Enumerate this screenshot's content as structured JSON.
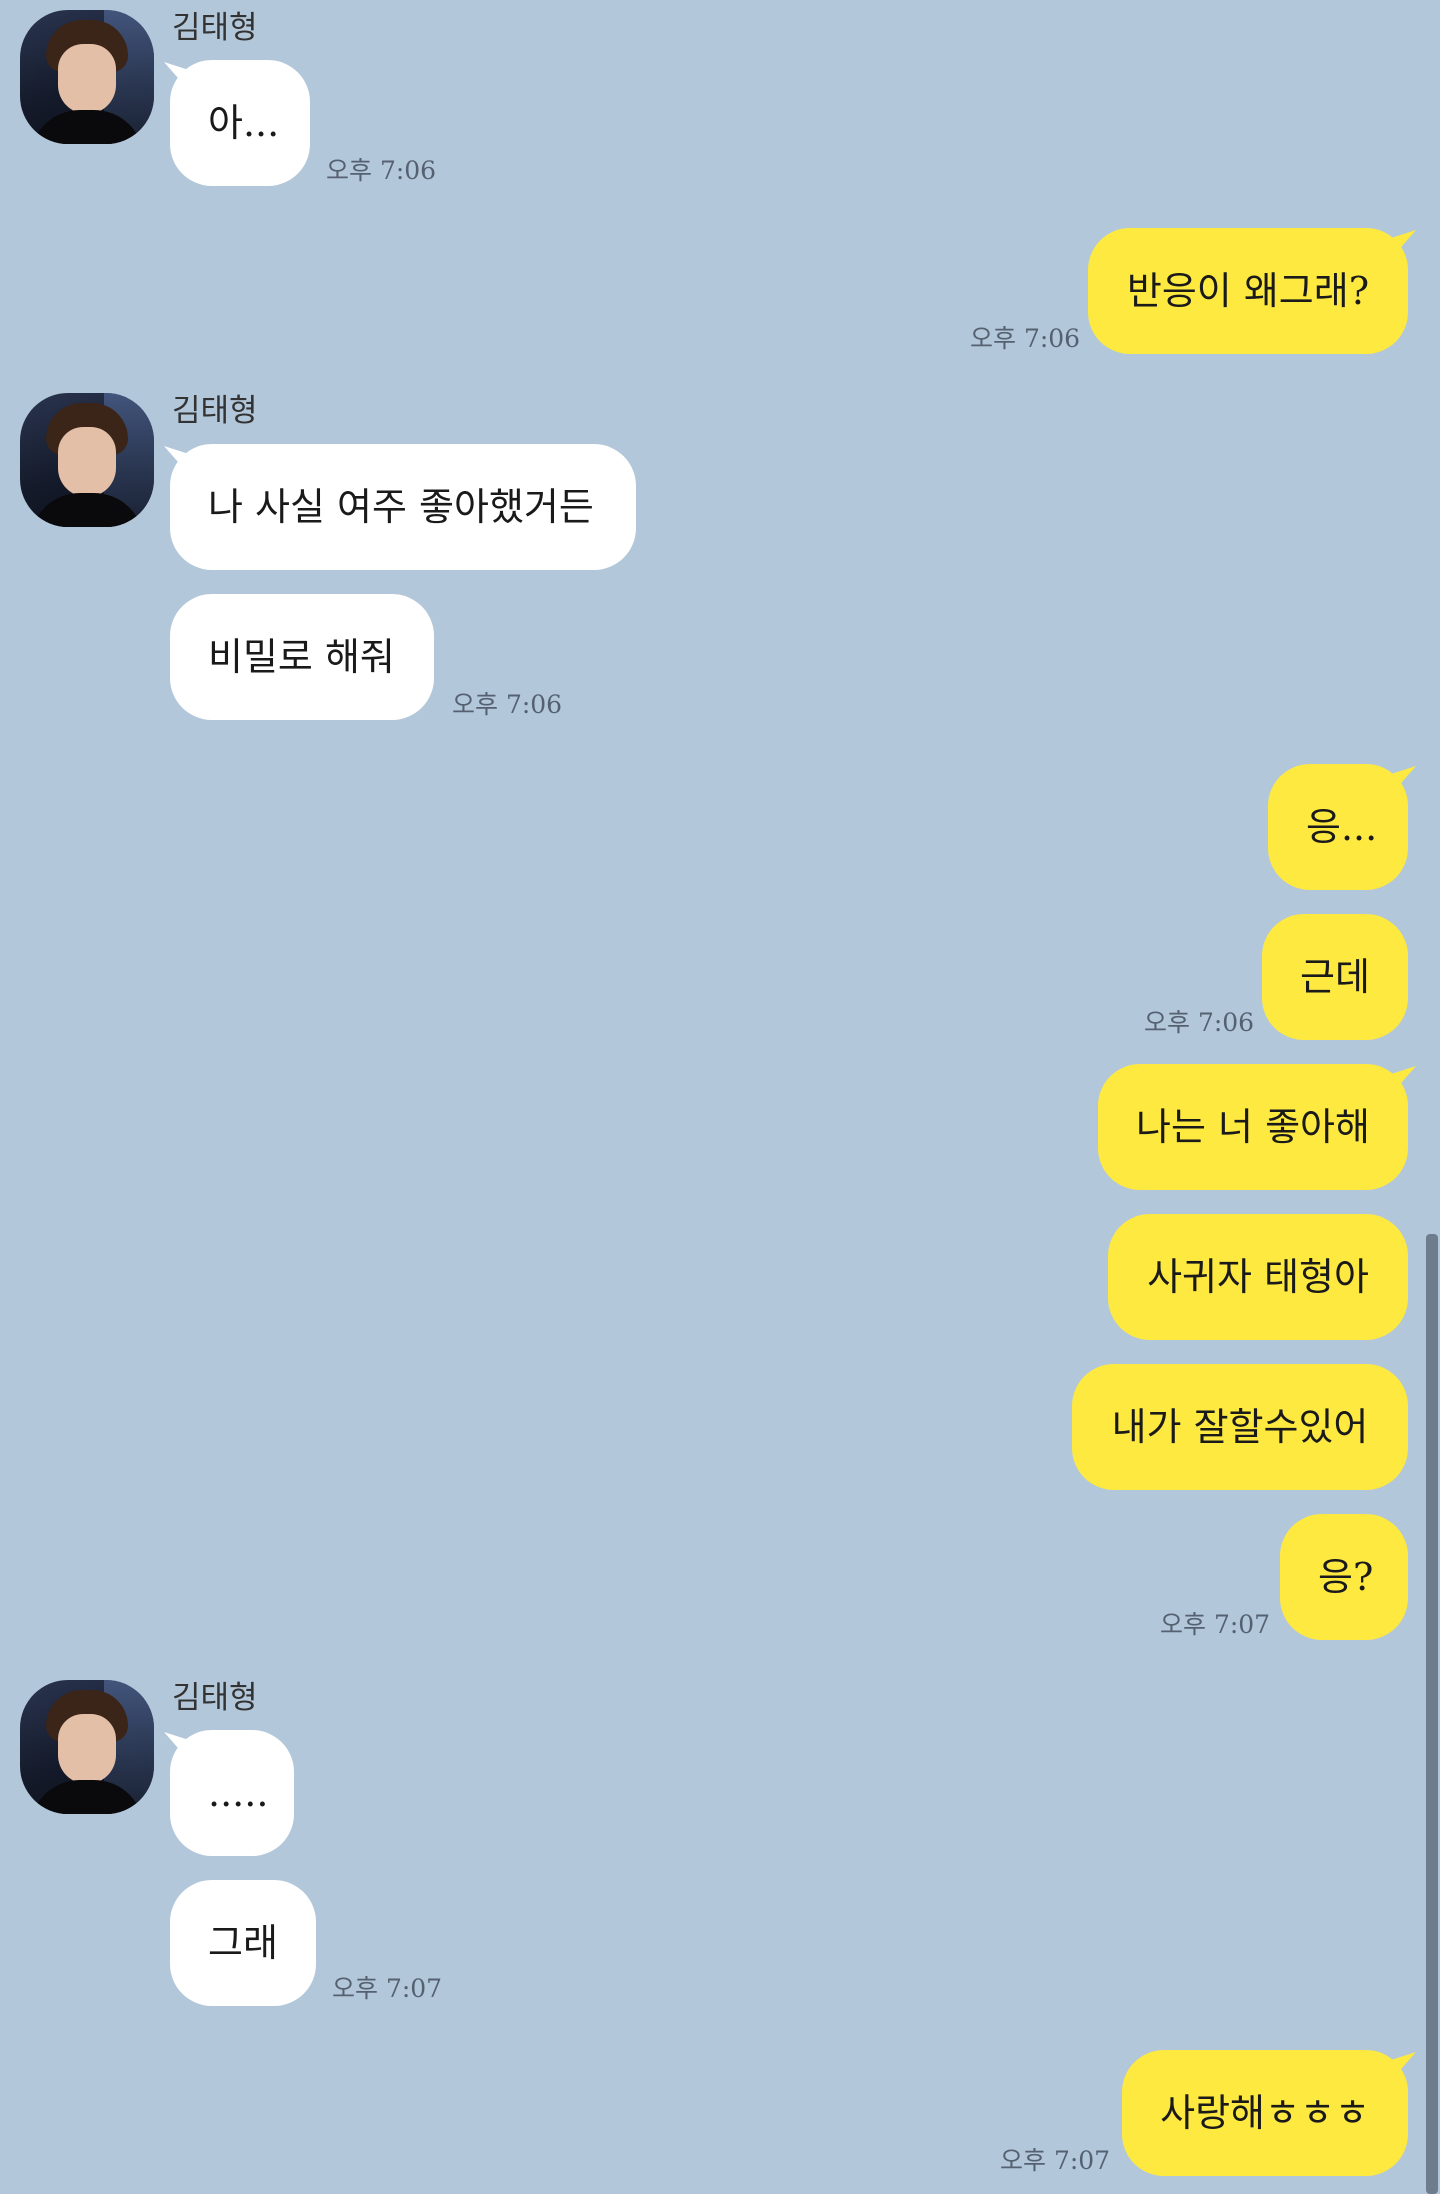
{
  "contact": {
    "name": "김태형"
  },
  "messages": {
    "m1": "아...",
    "m2": "반응이 왜그래?",
    "m3": "나 사실 여주 좋아했거든",
    "m4": "비밀로 해줘",
    "m5": "응...",
    "m6": "근데",
    "m7": "나는 너 좋아해",
    "m8": "사귀자 태형아",
    "m9": "내가 잘할수있어",
    "m10": "응?",
    "m11": ".....",
    "m12": "그래",
    "m13": "사랑해ㅎㅎㅎ"
  },
  "times": {
    "t1": "오후 7:06",
    "t2": "오후 7:06",
    "t3": "오후 7:06",
    "t4": "오후 7:06",
    "t5": "오후 7:07",
    "t6": "오후 7:07",
    "t7": "오후 7:07"
  },
  "colors": {
    "background": "#b2c7da",
    "incoming_bubble": "#ffffff",
    "outgoing_bubble": "#fee940"
  }
}
